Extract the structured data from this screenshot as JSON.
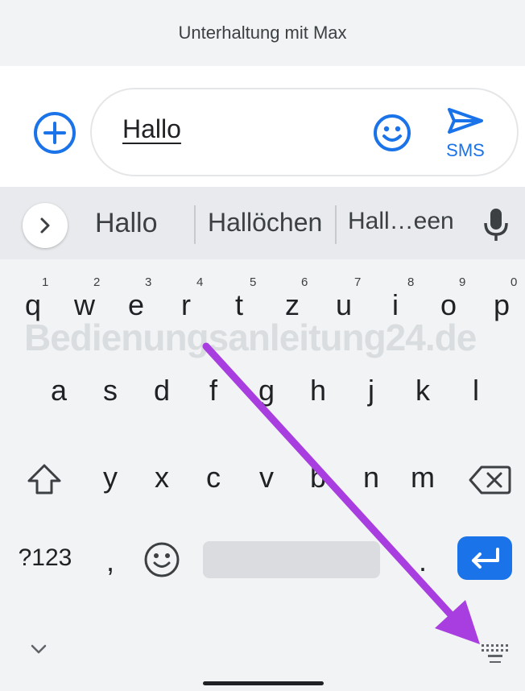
{
  "header": {
    "title": "Unterhaltung mit Max"
  },
  "compose": {
    "input_value": "Hallo",
    "send_label": "SMS",
    "accent_color": "#1a73e8"
  },
  "suggestions": [
    "Hallo",
    "Hallöchen",
    "Hall…een"
  ],
  "keyboard": {
    "row1": [
      {
        "key": "q",
        "num": "1"
      },
      {
        "key": "w",
        "num": "2"
      },
      {
        "key": "e",
        "num": "3"
      },
      {
        "key": "r",
        "num": "4"
      },
      {
        "key": "t",
        "num": "5"
      },
      {
        "key": "z",
        "num": "6"
      },
      {
        "key": "u",
        "num": "7"
      },
      {
        "key": "i",
        "num": "8"
      },
      {
        "key": "o",
        "num": "9"
      },
      {
        "key": "p",
        "num": "0"
      }
    ],
    "row2": [
      "a",
      "s",
      "d",
      "f",
      "g",
      "h",
      "j",
      "k",
      "l"
    ],
    "row3": [
      "y",
      "x",
      "c",
      "v",
      "b",
      "n",
      "m"
    ],
    "symbols_label": "?123",
    "comma": ",",
    "period": "."
  },
  "watermark": "Bedienungsanleitung24.de",
  "icons": {
    "add": "plus-circle-icon",
    "emoji": "smiley-icon",
    "send": "send-icon",
    "chevron": "chevron-right-icon",
    "mic": "microphone-icon",
    "shift": "shift-icon",
    "backspace": "backspace-icon",
    "enter": "enter-icon",
    "collapse": "chevron-down-icon",
    "keyboard": "keyboard-icon"
  },
  "annotation": {
    "arrow_color": "#a83ee0"
  }
}
